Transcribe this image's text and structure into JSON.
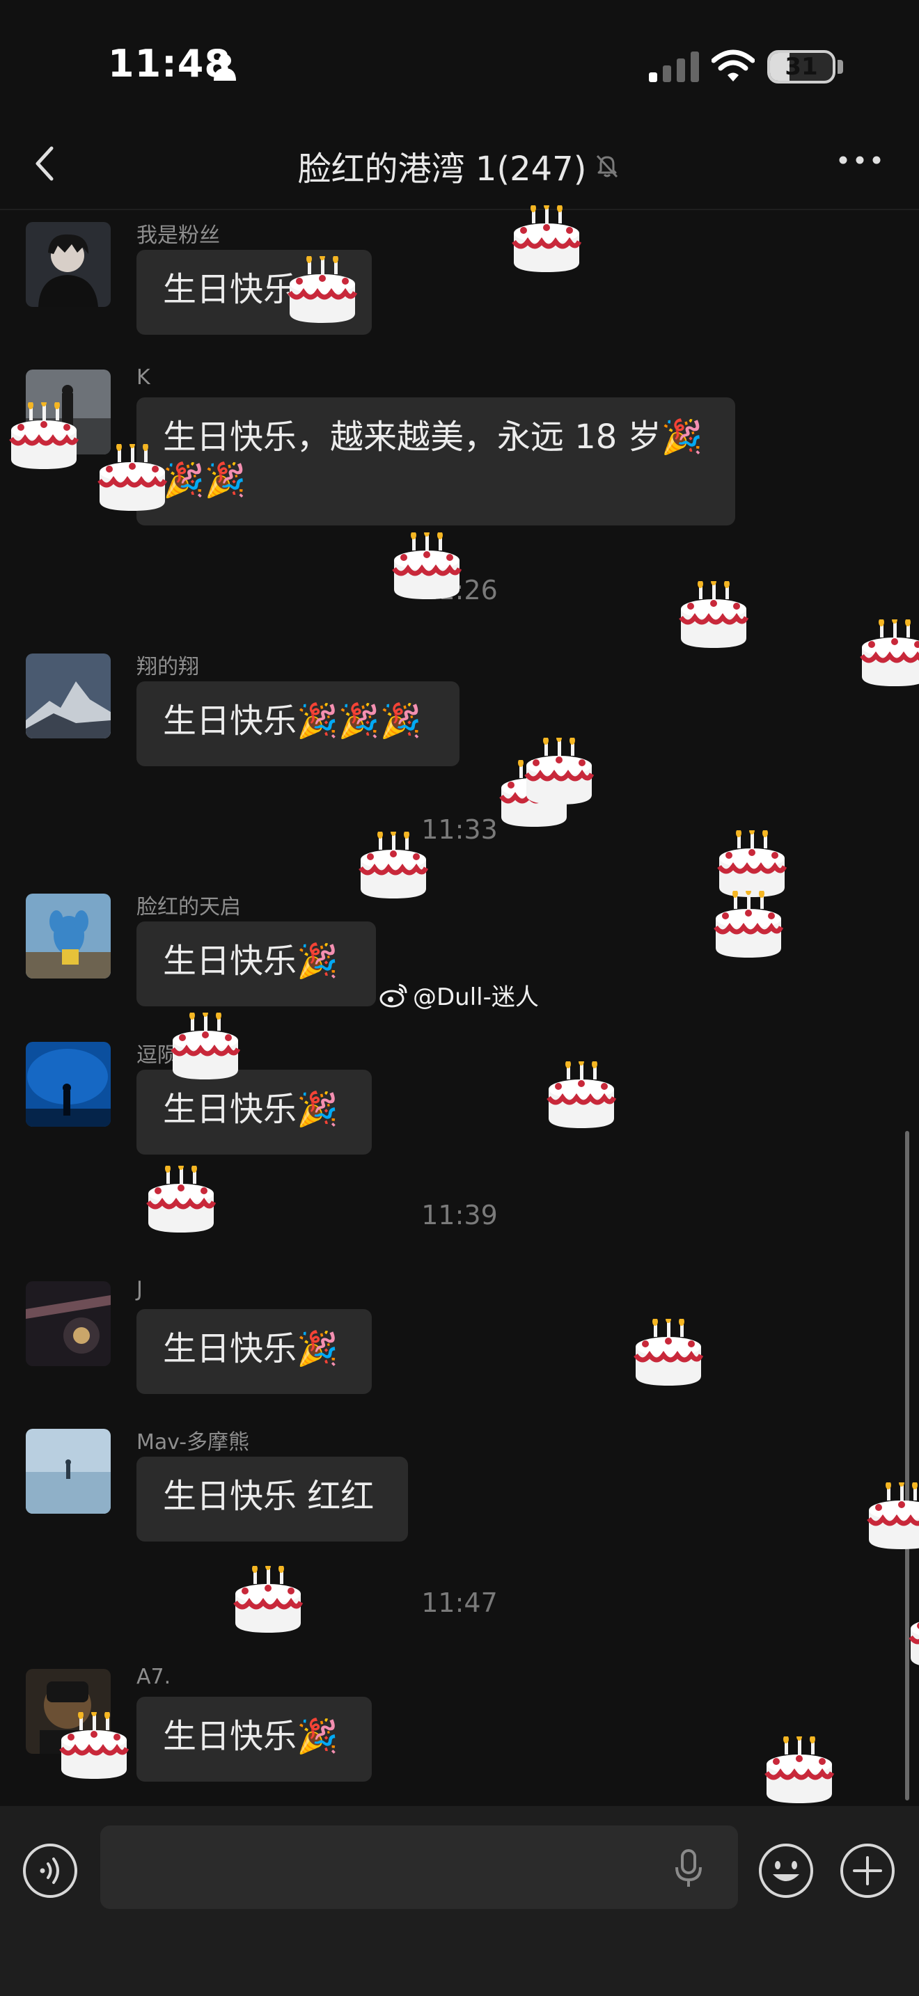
{
  "status_bar": {
    "time": "11:48",
    "battery": "31",
    "battery_level": 0.31
  },
  "header": {
    "title": "脸红的港湾 1(247)"
  },
  "messages": [
    {
      "sender": "我是粉丝",
      "text": "生日快乐"
    },
    {
      "sender": "K",
      "text_line1": "生日快乐，越来越美，永远 18 岁🎉",
      "text_line2": "🎉🎉"
    },
    {
      "sender": "翔的翔",
      "text": "生日快乐🎉🎉🎉"
    },
    {
      "sender": "脸红的天启",
      "text": "生日快乐🎉"
    },
    {
      "sender": "逗陨",
      "text": "生日快乐🎉"
    },
    {
      "sender": "J",
      "text": "生日快乐🎉"
    },
    {
      "sender": "Mav-多摩熊",
      "text": "生日快乐 红红"
    },
    {
      "sender": "A7.",
      "text": "生日快乐🎉"
    }
  ],
  "timestamps": [
    "11:26",
    "11:33",
    "11:39",
    "11:47"
  ],
  "watermark": "@Dull-迷人",
  "input": {
    "placeholder": ""
  },
  "icons": {
    "back": "chevron-left-icon",
    "mute": "bell-slash-icon",
    "more": "more-dots-icon",
    "voice": "voice-icon",
    "mic": "microphone-icon",
    "emoji": "emoji-icon",
    "plus": "plus-icon"
  },
  "colors": {
    "background": "#111111",
    "bubble": "#2b2b2b",
    "input_bar": "#1e1e1e",
    "cake_frosting": "#c8283a"
  }
}
